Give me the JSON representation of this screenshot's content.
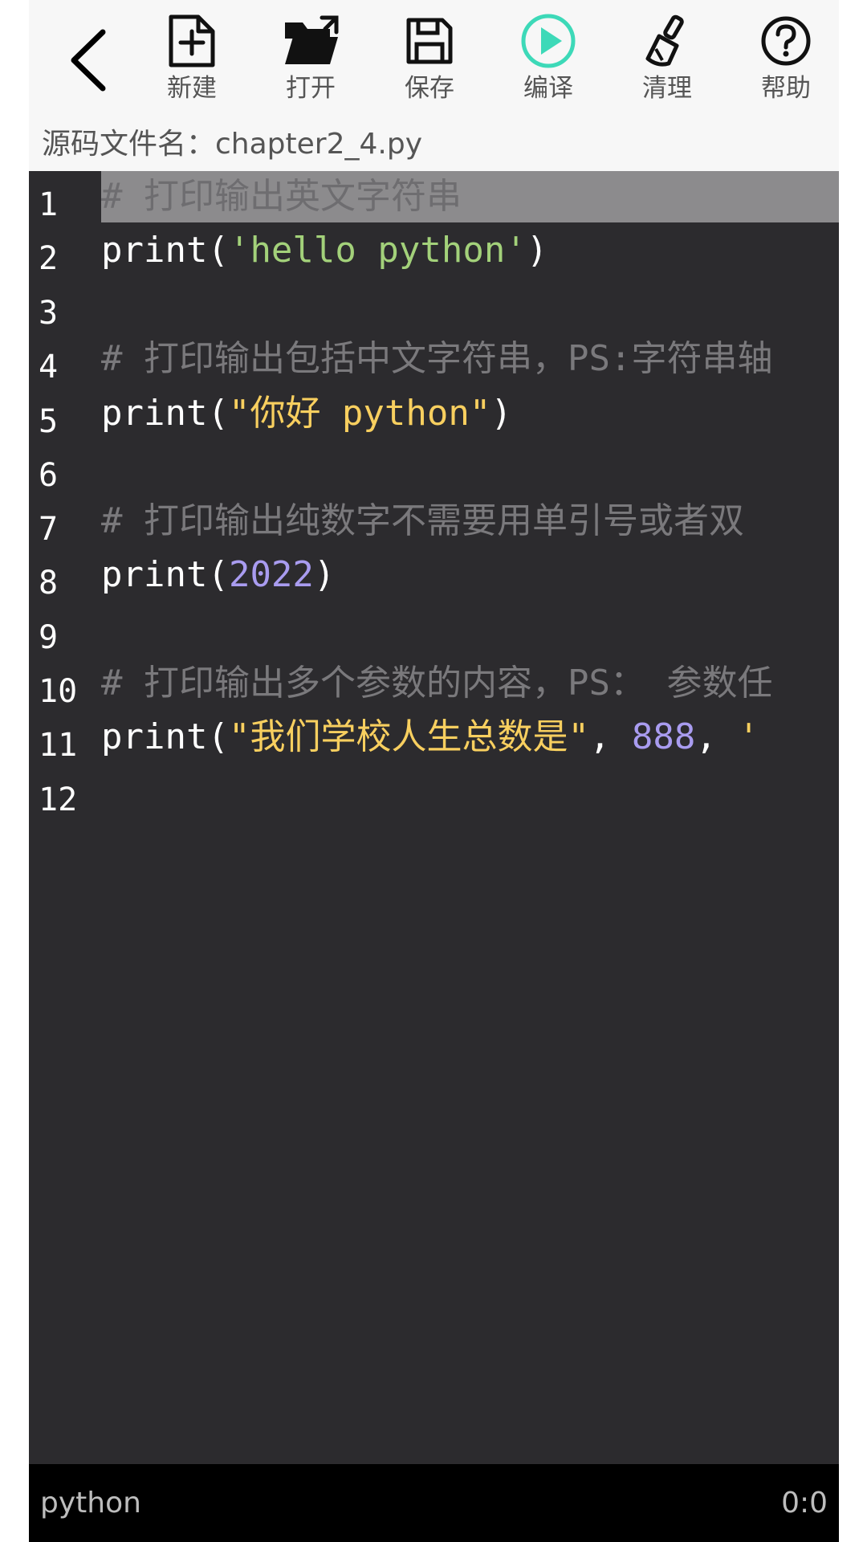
{
  "toolbar": {
    "tools": [
      {
        "label": "新建",
        "icon": "new-file-icon"
      },
      {
        "label": "打开",
        "icon": "open-folder-icon"
      },
      {
        "label": "保存",
        "icon": "save-icon"
      },
      {
        "label": "编译",
        "icon": "play-compile-icon"
      },
      {
        "label": "清理",
        "icon": "brush-clean-icon"
      },
      {
        "label": "帮助",
        "icon": "help-icon"
      }
    ]
  },
  "file": {
    "label": "源码文件名：",
    "name": "chapter2_4.py"
  },
  "editor": {
    "line_numbers": [
      "1",
      "2",
      "3",
      "4",
      "5",
      "6",
      "7",
      "8",
      "9",
      "10",
      "11",
      "12"
    ],
    "lines": [
      {
        "n": 1,
        "highlighted": true,
        "tokens": [
          {
            "text": "# 打印输出英文字符串",
            "type": "comment"
          }
        ]
      },
      {
        "n": 2,
        "tokens": [
          {
            "text": "print(",
            "type": "plain"
          },
          {
            "text": "'hello python'",
            "type": "string-green"
          },
          {
            "text": ")",
            "type": "plain"
          }
        ]
      },
      {
        "n": 3,
        "tokens": []
      },
      {
        "n": 4,
        "tokens": [
          {
            "text": "# 打印输出包括中文字符串，PS:字符串轴",
            "type": "comment"
          }
        ]
      },
      {
        "n": 5,
        "tokens": [
          {
            "text": "print(",
            "type": "plain"
          },
          {
            "text": "\"你好 python\"",
            "type": "string-yellow"
          },
          {
            "text": ")",
            "type": "plain"
          }
        ]
      },
      {
        "n": 6,
        "tokens": []
      },
      {
        "n": 7,
        "tokens": [
          {
            "text": "# 打印输出纯数字不需要用单引号或者双",
            "type": "comment"
          }
        ]
      },
      {
        "n": 8,
        "tokens": [
          {
            "text": "print(",
            "type": "plain"
          },
          {
            "text": "2022",
            "type": "number"
          },
          {
            "text": ")",
            "type": "plain"
          }
        ]
      },
      {
        "n": 9,
        "tokens": []
      },
      {
        "n": 10,
        "tokens": [
          {
            "text": "# 打印输出多个参数的内容，PS： 参数任",
            "type": "comment"
          }
        ]
      },
      {
        "n": 11,
        "tokens": [
          {
            "text": "print(",
            "type": "plain"
          },
          {
            "text": "\"我们学校人生总数是\"",
            "type": "string-yellow"
          },
          {
            "text": ", ",
            "type": "plain"
          },
          {
            "text": "888",
            "type": "number"
          },
          {
            "text": ", ",
            "type": "plain"
          },
          {
            "text": "'",
            "type": "string-yellow"
          }
        ]
      },
      {
        "n": 12,
        "tokens": []
      }
    ]
  },
  "status": {
    "language": "python",
    "cursor": "0:0"
  },
  "colors": {
    "accent": "#3dd9b8",
    "editor_bg": "#2c2b2e",
    "comment": "#7a797c",
    "string_green": "#a3d17a",
    "string_yellow": "#f8cf5f",
    "number": "#a99cf0"
  }
}
